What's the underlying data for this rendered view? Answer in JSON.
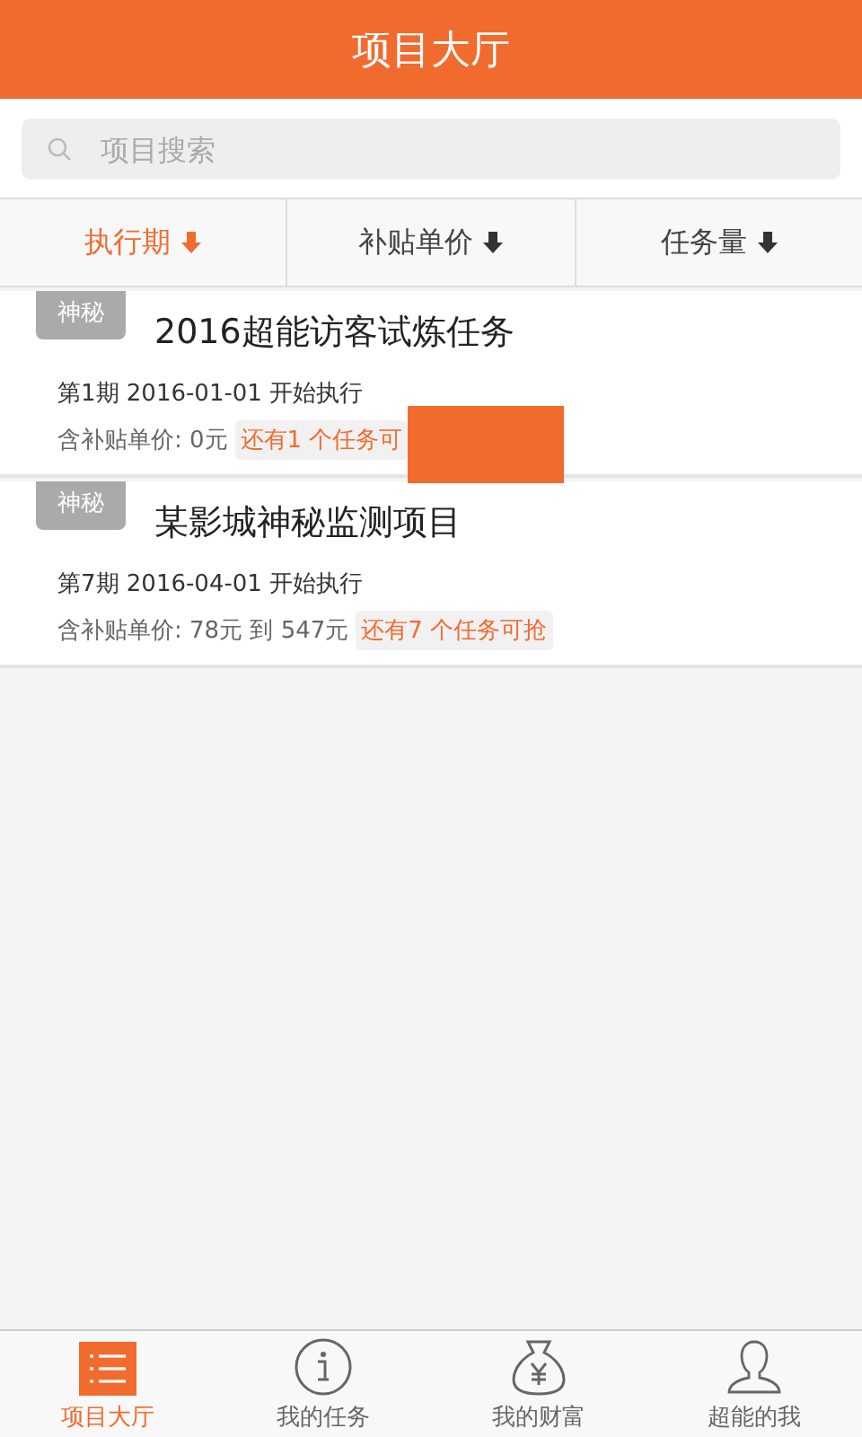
{
  "header": {
    "title": "项目大厅"
  },
  "search": {
    "placeholder": "项目搜索"
  },
  "sort_options": [
    {
      "label": "执行期",
      "selected": true
    },
    {
      "label": "补贴单价",
      "selected": false
    },
    {
      "label": "任务量",
      "selected": false
    }
  ],
  "projects": [
    {
      "tag": "神秘",
      "title": "2016超能访客试炼任务",
      "period": "第1期 2016-01-01 开始执行",
      "subsidy": "含补贴单价: 0元",
      "remaining": "还有1 个任务可",
      "covered": true
    },
    {
      "tag": "神秘",
      "title": "某影城神秘监测项目",
      "period": "第7期 2016-04-01 开始执行",
      "subsidy": "含补贴单价: 78元 到 547元",
      "remaining": "还有7 个任务可抢",
      "covered": false
    }
  ],
  "tabs": [
    {
      "label": "项目大厅",
      "kind": "list",
      "selected": true
    },
    {
      "label": "我的任务",
      "kind": "info",
      "selected": false
    },
    {
      "label": "我的财富",
      "kind": "money",
      "selected": false
    },
    {
      "label": "超能的我",
      "kind": "person",
      "selected": false
    }
  ]
}
